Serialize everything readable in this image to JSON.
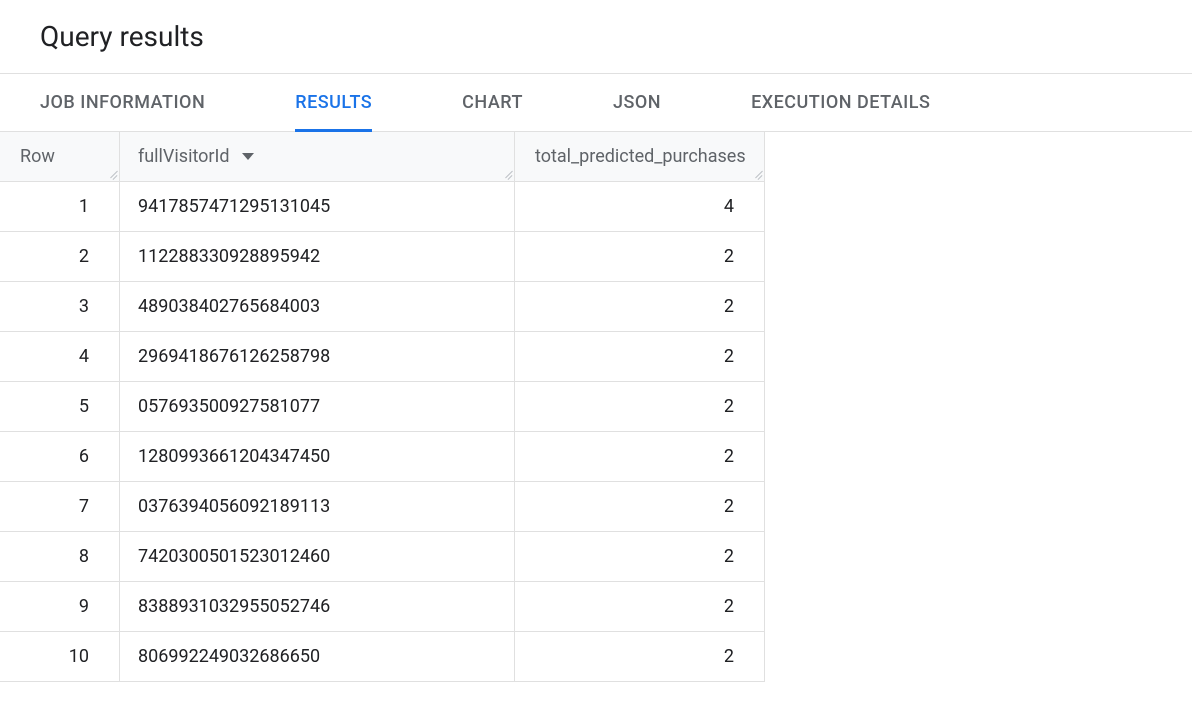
{
  "title": "Query results",
  "tabs": [
    {
      "label": "JOB INFORMATION",
      "active": false
    },
    {
      "label": "RESULTS",
      "active": true
    },
    {
      "label": "CHART",
      "active": false
    },
    {
      "label": "JSON",
      "active": false
    },
    {
      "label": "EXECUTION DETAILS",
      "active": false
    }
  ],
  "columns": {
    "row": "Row",
    "fullVisitorId": "fullVisitorId",
    "totalPredicted": "total_predicted_purchases"
  },
  "sort": {
    "column": "fullVisitorId",
    "direction": "desc"
  },
  "rows": [
    {
      "row": "1",
      "fullVisitorId": "9417857471295131045",
      "total_predicted_purchases": "4"
    },
    {
      "row": "2",
      "fullVisitorId": "112288330928895942",
      "total_predicted_purchases": "2"
    },
    {
      "row": "3",
      "fullVisitorId": "489038402765684003",
      "total_predicted_purchases": "2"
    },
    {
      "row": "4",
      "fullVisitorId": "2969418676126258798",
      "total_predicted_purchases": "2"
    },
    {
      "row": "5",
      "fullVisitorId": "057693500927581077",
      "total_predicted_purchases": "2"
    },
    {
      "row": "6",
      "fullVisitorId": "1280993661204347450",
      "total_predicted_purchases": "2"
    },
    {
      "row": "7",
      "fullVisitorId": "0376394056092189113",
      "total_predicted_purchases": "2"
    },
    {
      "row": "8",
      "fullVisitorId": "7420300501523012460",
      "total_predicted_purchases": "2"
    },
    {
      "row": "9",
      "fullVisitorId": "8388931032955052746",
      "total_predicted_purchases": "2"
    },
    {
      "row": "10",
      "fullVisitorId": "806992249032686650",
      "total_predicted_purchases": "2"
    }
  ]
}
